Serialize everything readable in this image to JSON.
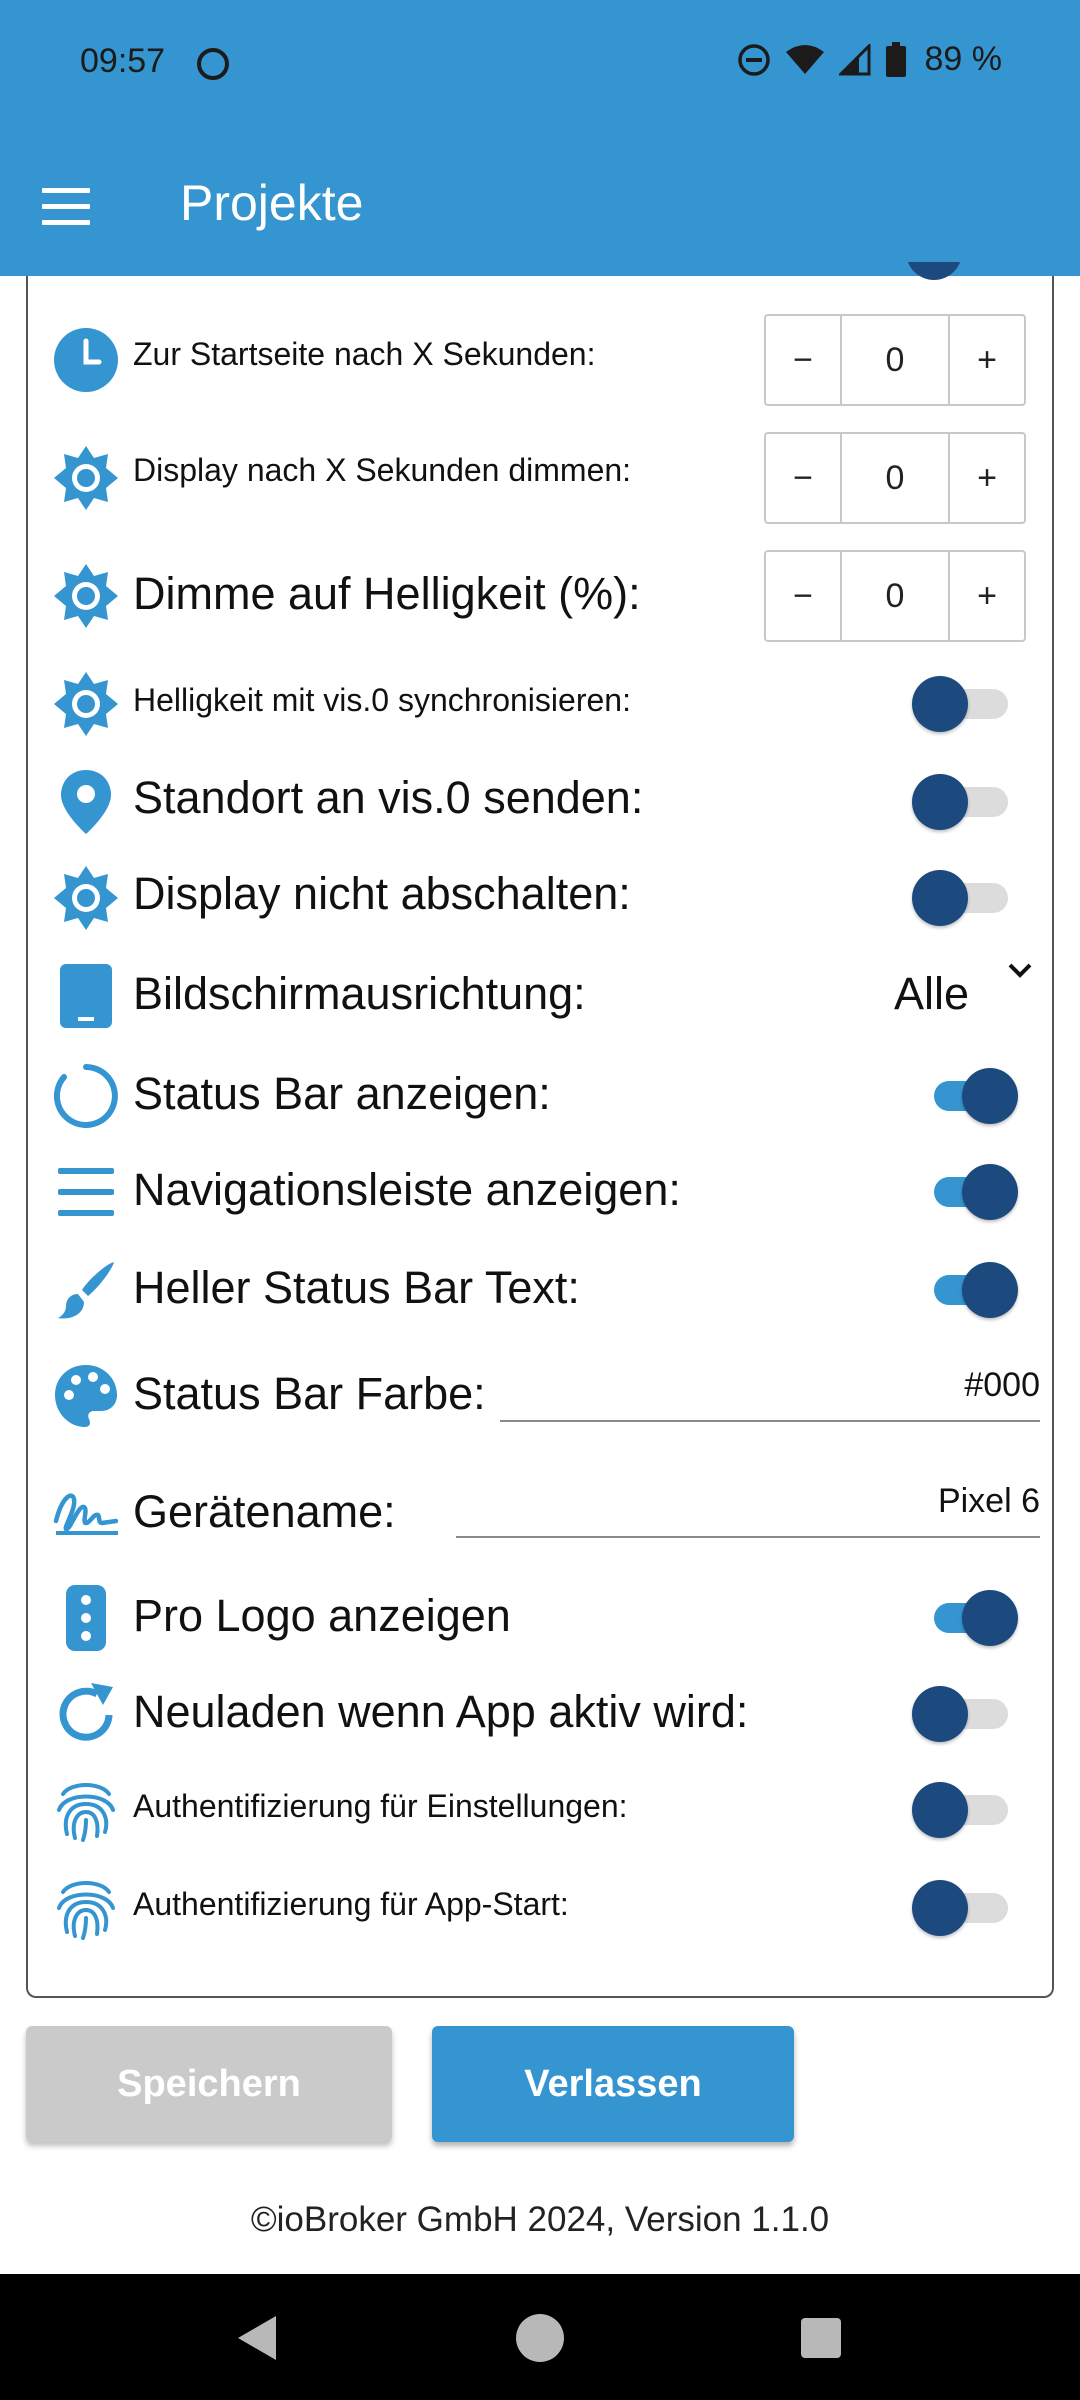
{
  "status": {
    "time": "09:57",
    "battery": "89 %"
  },
  "appbar": {
    "title": "Projekte"
  },
  "settings": {
    "home_timeout": {
      "label": "Zur Startseite nach X Sekunden:",
      "value": "0",
      "minus": "−",
      "plus": "+"
    },
    "dim_timeout": {
      "label": "Display nach X Sekunden dimmen:",
      "value": "0",
      "minus": "−",
      "plus": "+"
    },
    "dim_brightness": {
      "label": "Dimme auf Helligkeit (%):",
      "value": "0",
      "minus": "−",
      "plus": "+"
    },
    "sync_brightness": {
      "label": "Helligkeit mit vis.0 synchronisieren:",
      "on": false
    },
    "send_location": {
      "label": "Standort an vis.0 senden:",
      "on": false
    },
    "keep_screen_on": {
      "label": "Display nicht abschalten:",
      "on": false
    },
    "orientation": {
      "label": "Bildschirmausrichtung:",
      "value": "Alle"
    },
    "show_status_bar": {
      "label": "Status Bar anzeigen:",
      "on": true
    },
    "show_nav_bar": {
      "label": "Navigationsleiste anzeigen:",
      "on": true
    },
    "light_status_text": {
      "label": "Heller Status Bar Text:",
      "on": true
    },
    "status_bar_color": {
      "label": "Status Bar Farbe:",
      "value": "#000"
    },
    "device_name": {
      "label": "Gerätename:",
      "value": "Pixel 6"
    },
    "show_pro_logo": {
      "label": "Pro Logo anzeigen",
      "on": true
    },
    "reload_on_active": {
      "label": "Neuladen wenn App aktiv wird:",
      "on": false
    },
    "auth_settings": {
      "label": "Authentifizierung für Einstellungen:",
      "on": false
    },
    "auth_app_start": {
      "label": "Authentifizierung für App-Start:",
      "on": false
    }
  },
  "buttons": {
    "save": "Speichern",
    "leave": "Verlassen"
  },
  "footer": "©ioBroker GmbH 2024, Version 1.1.0",
  "colors": {
    "primary": "#3595d0",
    "toggle_knob": "#1c4a7f",
    "disabled_button": "#cacaca"
  }
}
